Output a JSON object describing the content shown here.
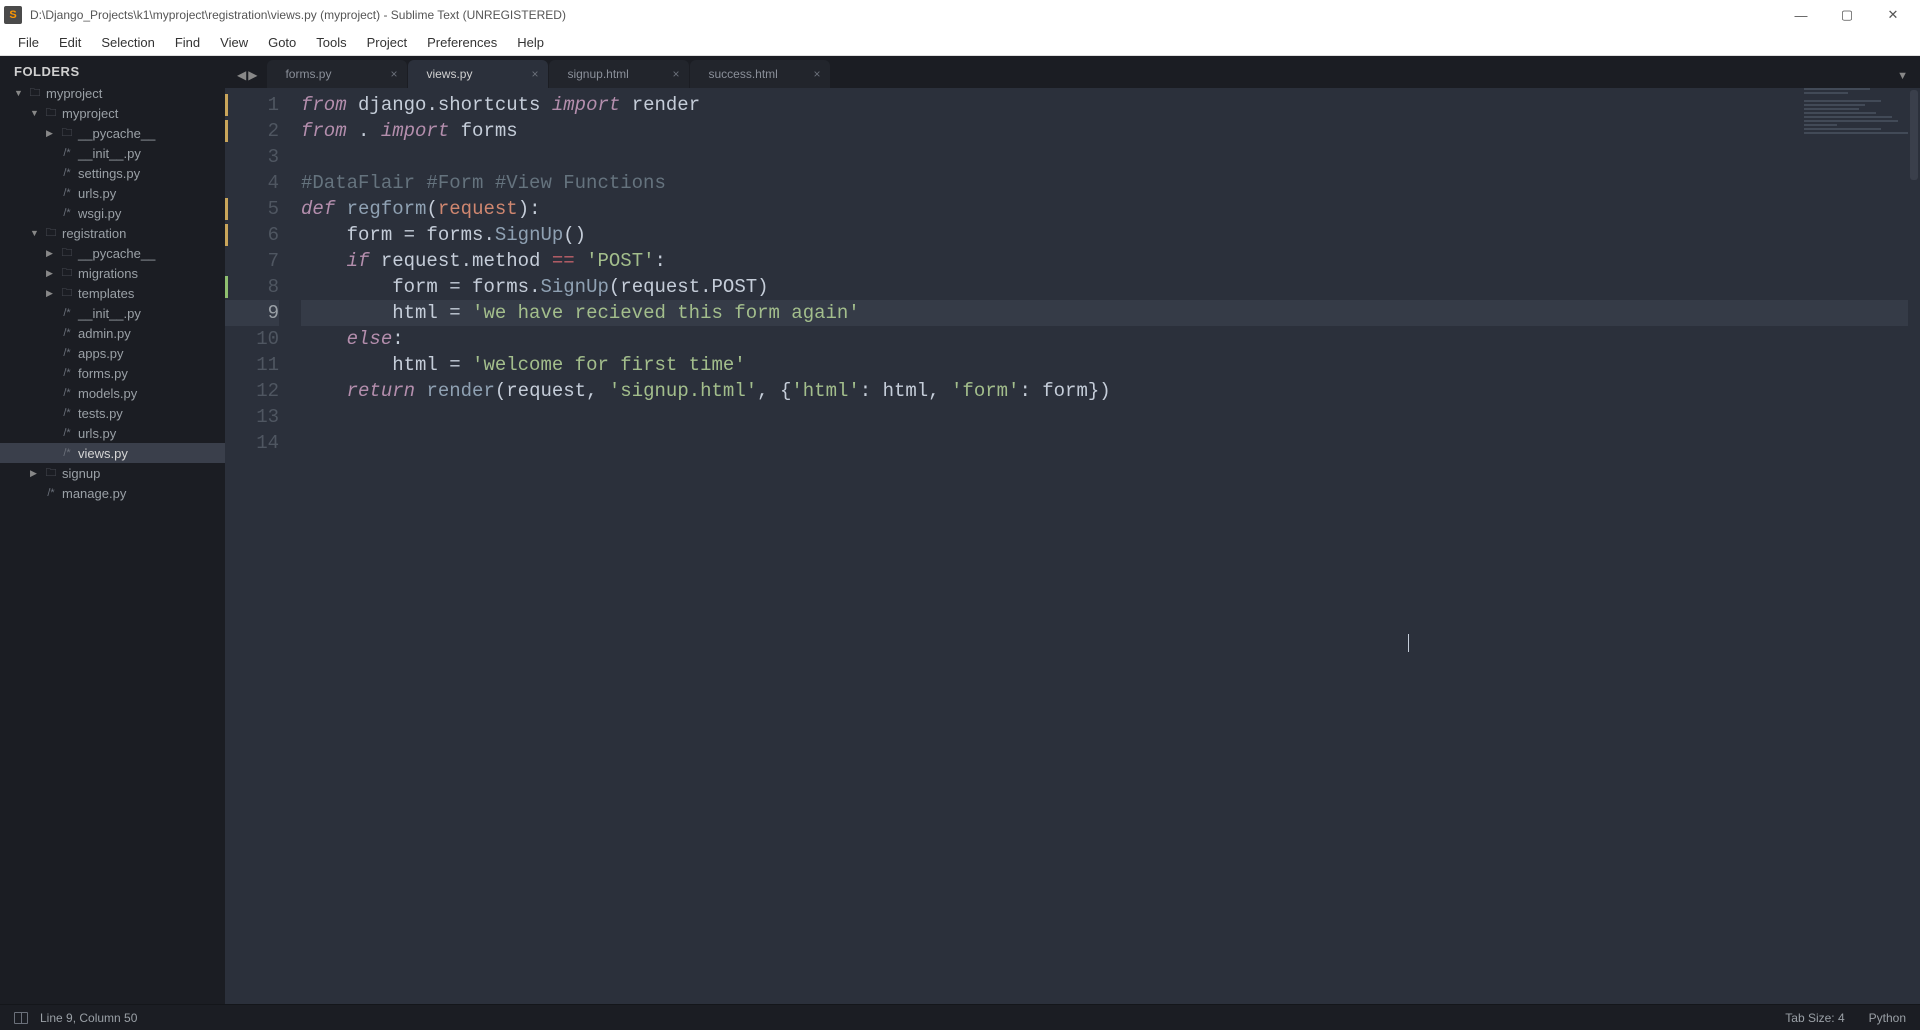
{
  "titlebar": {
    "icon_letter": "S",
    "title": "D:\\Django_Projects\\k1\\myproject\\registration\\views.py (myproject) - Sublime Text (UNREGISTERED)"
  },
  "menu": [
    "File",
    "Edit",
    "Selection",
    "Find",
    "View",
    "Goto",
    "Tools",
    "Project",
    "Preferences",
    "Help"
  ],
  "sidebar": {
    "header": "FOLDERS",
    "tree": [
      {
        "depth": 0,
        "chev": "▼",
        "icon": "folder",
        "label": "myproject"
      },
      {
        "depth": 1,
        "chev": "▼",
        "icon": "folder",
        "label": "myproject"
      },
      {
        "depth": 2,
        "chev": "▶",
        "icon": "folder",
        "label": "__pycache__"
      },
      {
        "depth": 2,
        "chev": "",
        "icon": "file",
        "label": "__init__.py"
      },
      {
        "depth": 2,
        "chev": "",
        "icon": "file",
        "label": "settings.py"
      },
      {
        "depth": 2,
        "chev": "",
        "icon": "file",
        "label": "urls.py"
      },
      {
        "depth": 2,
        "chev": "",
        "icon": "file",
        "label": "wsgi.py"
      },
      {
        "depth": 1,
        "chev": "▼",
        "icon": "folder",
        "label": "registration"
      },
      {
        "depth": 2,
        "chev": "▶",
        "icon": "folder",
        "label": "__pycache__"
      },
      {
        "depth": 2,
        "chev": "▶",
        "icon": "folder",
        "label": "migrations"
      },
      {
        "depth": 2,
        "chev": "▶",
        "icon": "folder",
        "label": "templates"
      },
      {
        "depth": 2,
        "chev": "",
        "icon": "file",
        "label": "__init__.py"
      },
      {
        "depth": 2,
        "chev": "",
        "icon": "file",
        "label": "admin.py"
      },
      {
        "depth": 2,
        "chev": "",
        "icon": "file",
        "label": "apps.py"
      },
      {
        "depth": 2,
        "chev": "",
        "icon": "file",
        "label": "forms.py"
      },
      {
        "depth": 2,
        "chev": "",
        "icon": "file",
        "label": "models.py"
      },
      {
        "depth": 2,
        "chev": "",
        "icon": "file",
        "label": "tests.py"
      },
      {
        "depth": 2,
        "chev": "",
        "icon": "file",
        "label": "urls.py"
      },
      {
        "depth": 2,
        "chev": "",
        "icon": "file",
        "label": "views.py",
        "active": true
      },
      {
        "depth": 1,
        "chev": "▶",
        "icon": "folder",
        "label": "signup"
      },
      {
        "depth": 1,
        "chev": "",
        "icon": "file",
        "label": "manage.py"
      }
    ]
  },
  "tabs": [
    {
      "label": "forms.py",
      "active": false
    },
    {
      "label": "views.py",
      "active": true
    },
    {
      "label": "signup.html",
      "active": false
    },
    {
      "label": "success.html",
      "active": false
    }
  ],
  "history_nav": {
    "back": "◀",
    "forward": "▶"
  },
  "tab_menu_glyph": "▼",
  "code": {
    "line_numbers": [
      1,
      2,
      3,
      4,
      5,
      6,
      7,
      8,
      9,
      10,
      11,
      12,
      13,
      14
    ],
    "gutter_marks": {
      "1": "mod",
      "2": "mod",
      "5": "mod",
      "6": "mod",
      "8": "add"
    },
    "current_line": 9,
    "lines": [
      [
        {
          "t": "from",
          "c": "kw1"
        },
        {
          "t": " django",
          "c": "ident"
        },
        {
          "t": ".",
          "c": "punct"
        },
        {
          "t": "shortcuts",
          "c": "ident"
        },
        {
          "t": " ",
          "c": ""
        },
        {
          "t": "import",
          "c": "kw1"
        },
        {
          "t": " render",
          "c": "ident"
        }
      ],
      [
        {
          "t": "from",
          "c": "kw1"
        },
        {
          "t": " ",
          "c": ""
        },
        {
          "t": ".",
          "c": "punct"
        },
        {
          "t": " ",
          "c": ""
        },
        {
          "t": "import",
          "c": "kw1"
        },
        {
          "t": " forms",
          "c": "ident"
        }
      ],
      [],
      [
        {
          "t": "#DataFlair #Form #View Functions",
          "c": "comment"
        }
      ],
      [
        {
          "t": "def",
          "c": "kw-def"
        },
        {
          "t": " ",
          "c": ""
        },
        {
          "t": "regform",
          "c": "fn"
        },
        {
          "t": "(",
          "c": "punct"
        },
        {
          "t": "request",
          "c": "param"
        },
        {
          "t": ")",
          "c": "punct"
        },
        {
          "t": ":",
          "c": "punct"
        }
      ],
      [
        {
          "t": "    form ",
          "c": "ident"
        },
        {
          "t": "=",
          "c": "op"
        },
        {
          "t": " forms",
          "c": "ident"
        },
        {
          "t": ".",
          "c": "punct"
        },
        {
          "t": "SignUp",
          "c": "call"
        },
        {
          "t": "()",
          "c": "punct"
        }
      ],
      [
        {
          "t": "    ",
          "c": ""
        },
        {
          "t": "if",
          "c": "kw1"
        },
        {
          "t": " request",
          "c": "ident"
        },
        {
          "t": ".",
          "c": "punct"
        },
        {
          "t": "method ",
          "c": "ident"
        },
        {
          "t": "==",
          "c": "cmp"
        },
        {
          "t": " ",
          "c": ""
        },
        {
          "t": "'POST'",
          "c": "str"
        },
        {
          "t": ":",
          "c": "punct"
        }
      ],
      [
        {
          "t": "        form ",
          "c": "ident"
        },
        {
          "t": "=",
          "c": "op"
        },
        {
          "t": " forms",
          "c": "ident"
        },
        {
          "t": ".",
          "c": "punct"
        },
        {
          "t": "SignUp",
          "c": "call"
        },
        {
          "t": "(",
          "c": "punct"
        },
        {
          "t": "request",
          "c": "ident"
        },
        {
          "t": ".",
          "c": "punct"
        },
        {
          "t": "POST",
          "c": "ident"
        },
        {
          "t": ")",
          "c": "punct"
        }
      ],
      [
        {
          "t": "        html ",
          "c": "ident"
        },
        {
          "t": "=",
          "c": "op"
        },
        {
          "t": " ",
          "c": ""
        },
        {
          "t": "'we have recieved this form again'",
          "c": "str"
        }
      ],
      [
        {
          "t": "    ",
          "c": ""
        },
        {
          "t": "else",
          "c": "kw1"
        },
        {
          "t": ":",
          "c": "punct"
        }
      ],
      [
        {
          "t": "        html ",
          "c": "ident"
        },
        {
          "t": "=",
          "c": "op"
        },
        {
          "t": " ",
          "c": ""
        },
        {
          "t": "'welcome for first time'",
          "c": "str"
        }
      ],
      [
        {
          "t": "    ",
          "c": ""
        },
        {
          "t": "return",
          "c": "kw1"
        },
        {
          "t": " ",
          "c": ""
        },
        {
          "t": "render",
          "c": "call"
        },
        {
          "t": "(",
          "c": "punct"
        },
        {
          "t": "request",
          "c": "ident"
        },
        {
          "t": ",",
          "c": "punct"
        },
        {
          "t": " ",
          "c": ""
        },
        {
          "t": "'signup.html'",
          "c": "str"
        },
        {
          "t": ",",
          "c": "punct"
        },
        {
          "t": " ",
          "c": ""
        },
        {
          "t": "{",
          "c": "punct"
        },
        {
          "t": "'html'",
          "c": "str"
        },
        {
          "t": ":",
          "c": "punct"
        },
        {
          "t": " html",
          "c": "ident"
        },
        {
          "t": ",",
          "c": "punct"
        },
        {
          "t": " ",
          "c": ""
        },
        {
          "t": "'form'",
          "c": "str"
        },
        {
          "t": ":",
          "c": "punct"
        },
        {
          "t": " form",
          "c": "ident"
        },
        {
          "t": "}",
          "c": "punct"
        },
        {
          "t": ")",
          "c": "punct"
        }
      ],
      [],
      []
    ]
  },
  "statusbar": {
    "position": "Line 9, Column 50",
    "tab_size": "Tab Size: 4",
    "syntax": "Python"
  },
  "win_controls": {
    "min": "—",
    "max": "▢",
    "close": "✕"
  }
}
